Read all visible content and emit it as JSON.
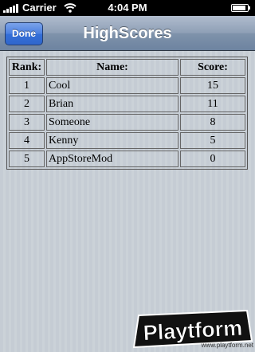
{
  "status_bar": {
    "carrier": "Carrier",
    "time": "4:04 PM",
    "battery_level": 0.9
  },
  "nav_bar": {
    "done_label": "Done",
    "title": "HighScores"
  },
  "table": {
    "headers": {
      "rank": "Rank:",
      "name": "Name:",
      "score": "Score:"
    },
    "rows": [
      {
        "rank": "1",
        "name": "Cool",
        "score": "15"
      },
      {
        "rank": "2",
        "name": "Brian",
        "score": "11"
      },
      {
        "rank": "3",
        "name": "Someone",
        "score": "8"
      },
      {
        "rank": "4",
        "name": "Kenny",
        "score": "5"
      },
      {
        "rank": "5",
        "name": "AppStoreMod",
        "score": "0"
      }
    ]
  },
  "watermark": {
    "logo_text": "Playtform",
    "url": "www.playtform.net"
  },
  "colors": {
    "nav_bar": "#7f93ab",
    "done_button": "#346fd8",
    "background": "#c5ccd4"
  }
}
